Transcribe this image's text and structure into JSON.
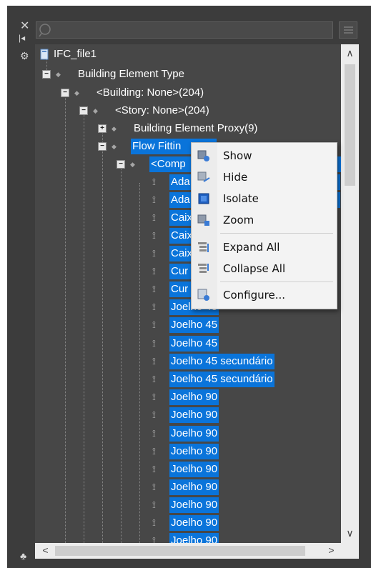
{
  "left_toolbar": {
    "close_glyph": "✕",
    "pin_glyph": "|◂",
    "gear_glyph": "⚙",
    "tree_glyph": "♣"
  },
  "search": {
    "placeholder": ""
  },
  "tree": {
    "root": "IFC_file1",
    "items": [
      {
        "label": "Building Element Type"
      },
      {
        "label": "<Building: None>(204)"
      },
      {
        "label": "<Story: None>(204)"
      },
      {
        "label": "Building Element Proxy(9)"
      },
      {
        "label": "Flow Fittin"
      },
      {
        "label": "<Comp"
      },
      {
        "label": "Ada"
      },
      {
        "label": "Ada"
      },
      {
        "label": "Caix"
      },
      {
        "label": "Caix"
      },
      {
        "label": "Caix"
      },
      {
        "label": "Cur"
      },
      {
        "label": "Cur"
      },
      {
        "label": "Joelho 45"
      },
      {
        "label": "Joelho 45"
      },
      {
        "label": "Joelho 45"
      },
      {
        "label": "Joelho 45 secundário"
      },
      {
        "label": "Joelho 45 secundário"
      },
      {
        "label": "Joelho 90"
      },
      {
        "label": "Joelho 90"
      },
      {
        "label": "Joelho 90"
      },
      {
        "label": "Joelho 90"
      },
      {
        "label": "Joelho 90"
      },
      {
        "label": "Joelho 90"
      },
      {
        "label": "Joelho 90"
      },
      {
        "label": "Joelho 90"
      },
      {
        "label": "Joelho 90"
      }
    ]
  },
  "context_menu": {
    "show": "Show",
    "hide": "Hide",
    "isolate": "Isolate",
    "zoom": "Zoom",
    "expand_all": "Expand All",
    "collapse_all": "Collapse All",
    "configure": "Configure..."
  },
  "scroll": {
    "up": "∧",
    "down": "∨",
    "left": "<",
    "right": ">"
  },
  "colors": {
    "selection": "#0a74da",
    "panel": "#474747"
  }
}
